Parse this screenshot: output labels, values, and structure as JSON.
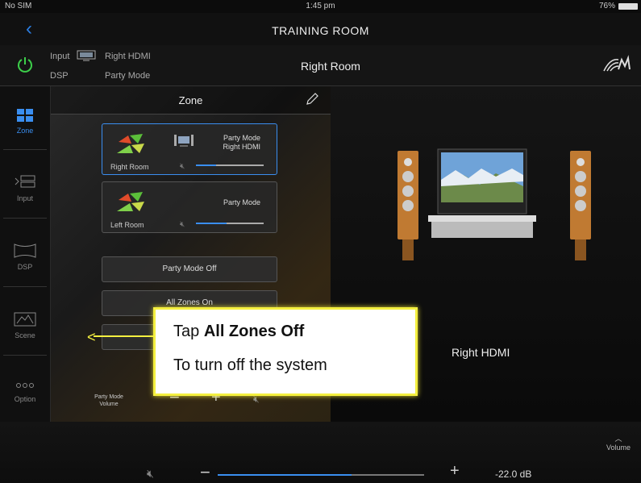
{
  "status": {
    "carrier": "No SIM",
    "time": "1:45 pm",
    "battery": "76%"
  },
  "titlebar": {
    "title": "TRAINING ROOM",
    "back": "‹"
  },
  "header": {
    "input_label": "Input",
    "input_value": "Right HDMI",
    "dsp_label": "DSP",
    "dsp_value": "Party Mode",
    "room": "Right Room"
  },
  "sidebar": {
    "items": [
      {
        "label": "Zone",
        "active": true
      },
      {
        "label": "Input",
        "active": false
      },
      {
        "label": "DSP",
        "active": false
      },
      {
        "label": "Scene",
        "active": false
      },
      {
        "label": "Option",
        "active": false
      }
    ]
  },
  "main": {
    "title": "Zone",
    "zones": [
      {
        "mode": "Party Mode",
        "input": "Right HDMI",
        "name": "Right Room",
        "level": 0.3
      },
      {
        "mode": "Party Mode",
        "input": "",
        "name": "Left Room",
        "level": 0.45
      }
    ],
    "buttons": {
      "party_off": "Party Mode Off",
      "all_on": "All Zones On"
    },
    "party_volume": {
      "line1": "Party Mode",
      "line2": "Volume"
    }
  },
  "right": {
    "input_name": "Right HDMI"
  },
  "bottom": {
    "volume_label": "Volume",
    "db": "-22.0 dB",
    "level": 0.65
  },
  "callout": {
    "tap": "Tap ",
    "bold": "All Zones Off",
    "line2": "To turn off the system"
  },
  "colors": {
    "accent": "#3a8ef0",
    "callout_border": "#f4f040"
  }
}
